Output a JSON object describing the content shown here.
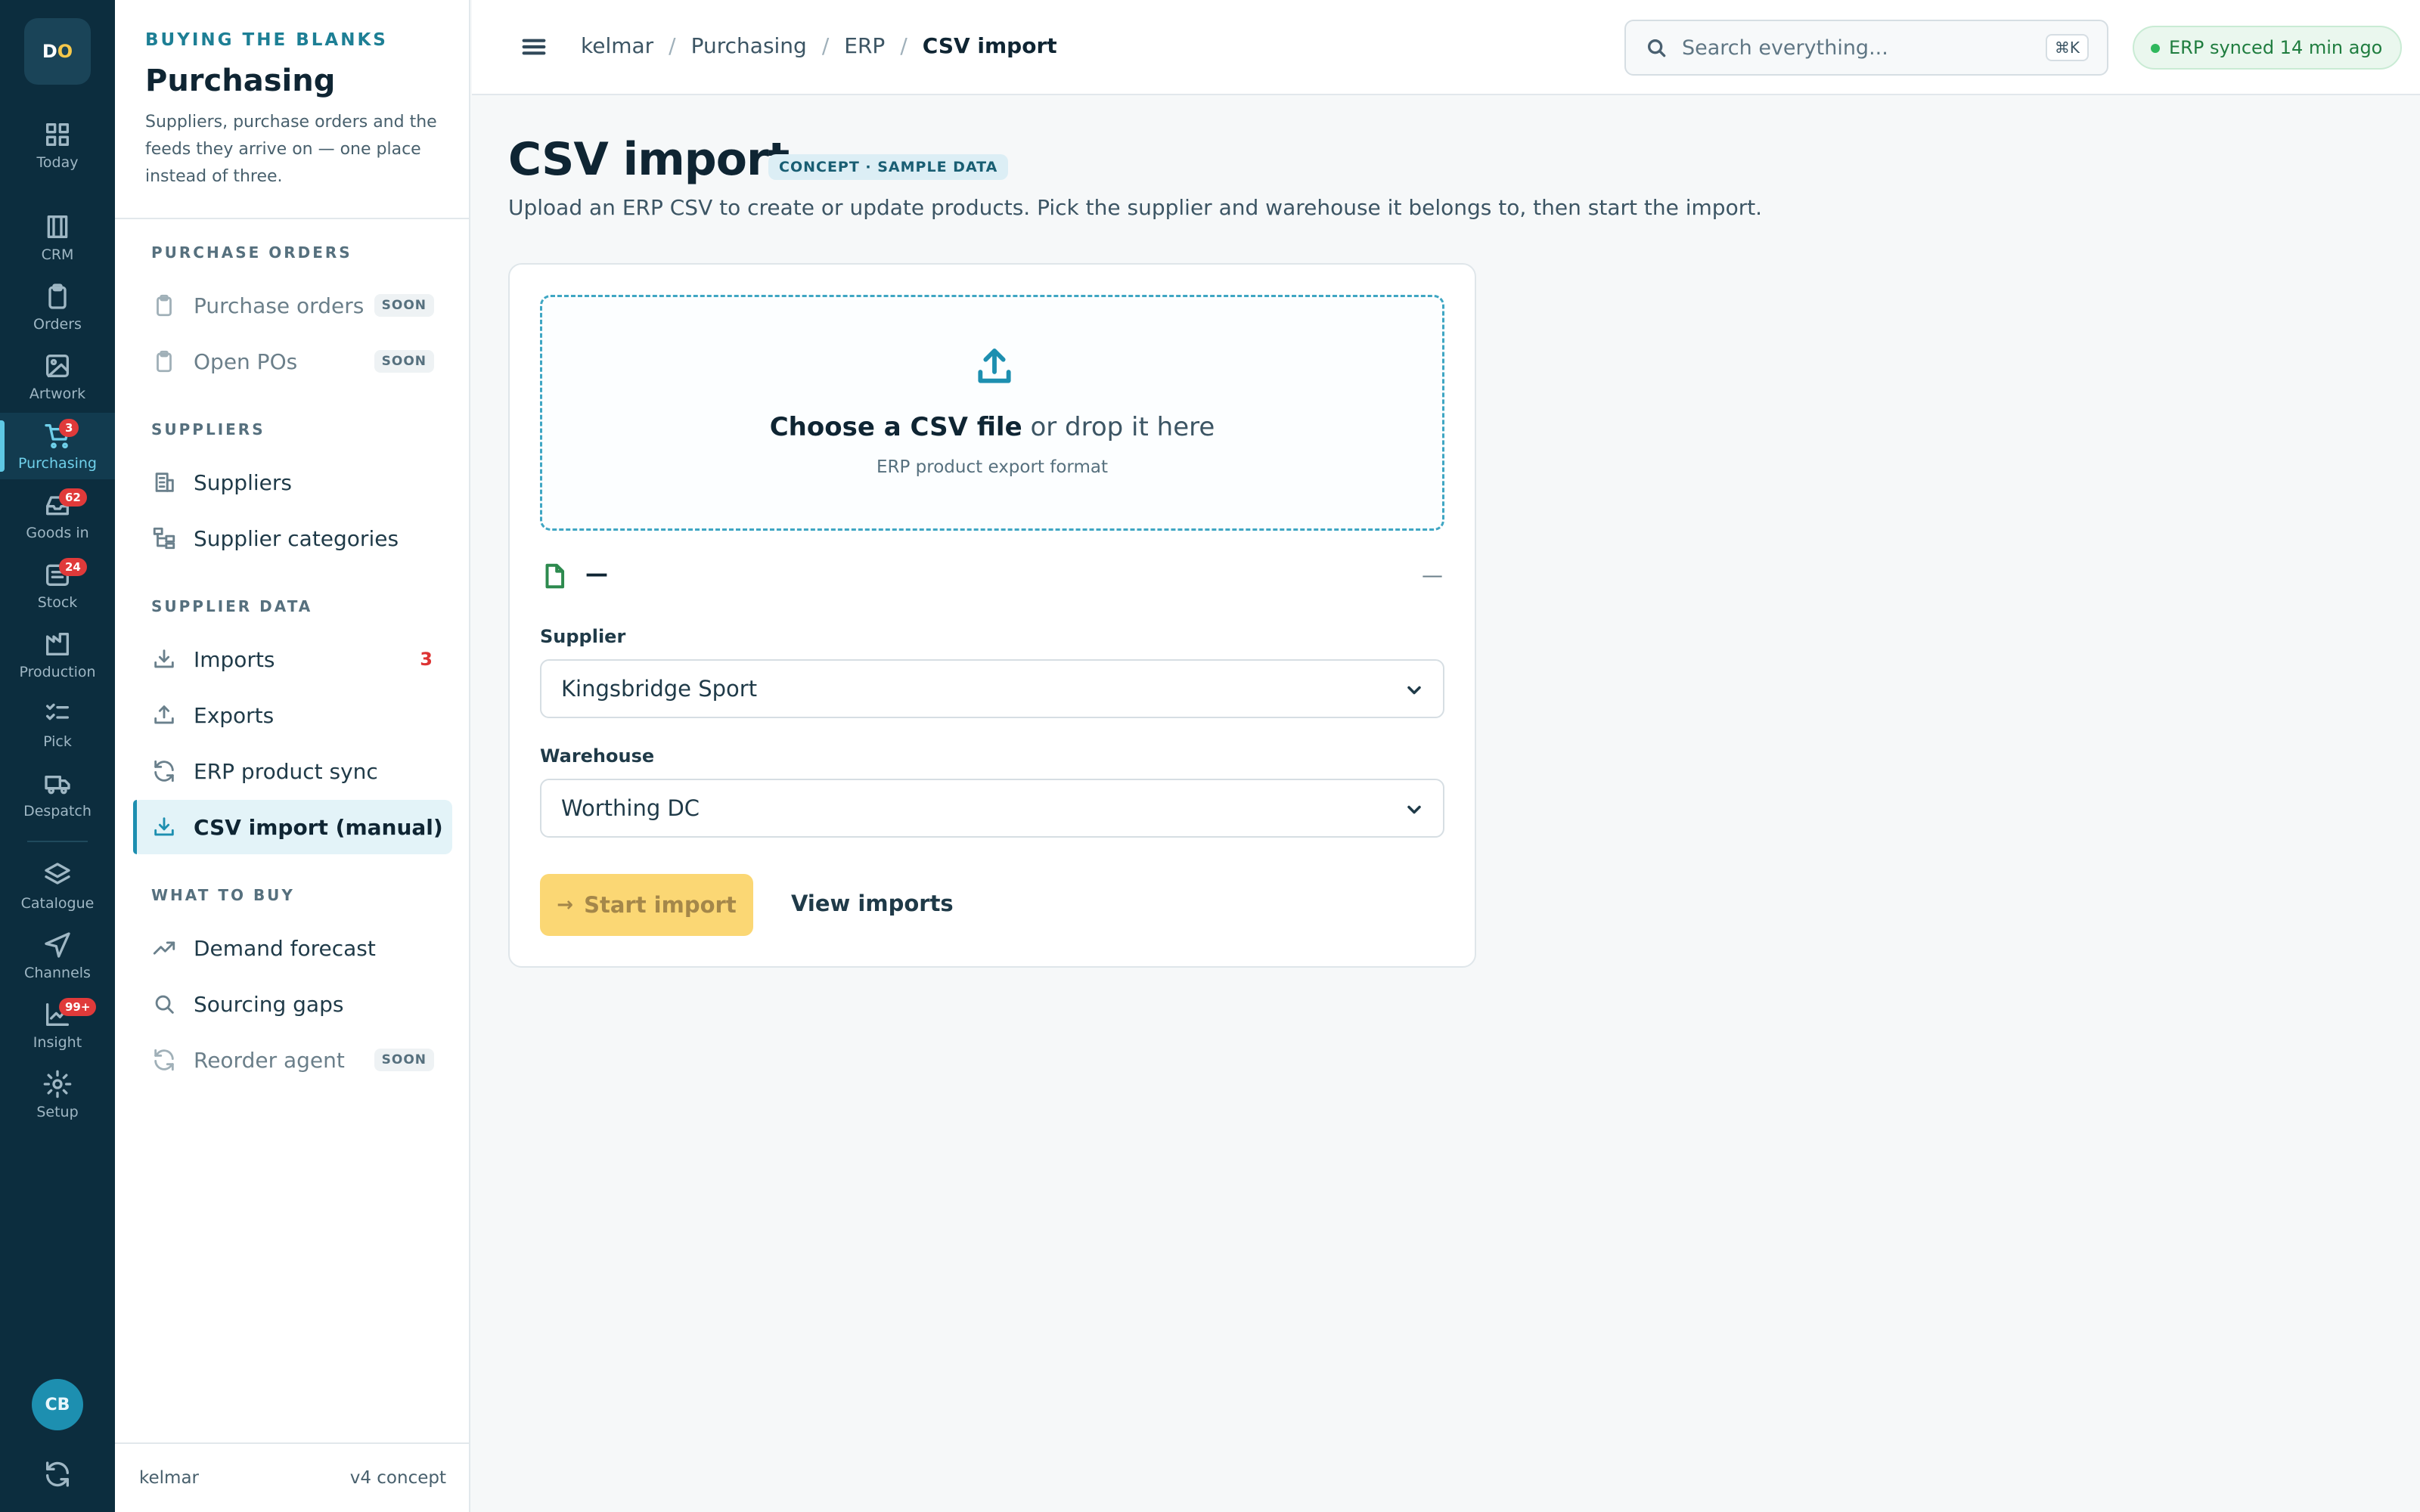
{
  "rail": {
    "logo_d": "D",
    "logo_o": "O",
    "items": [
      {
        "label": "Today",
        "icon": "grid-icon"
      },
      {
        "label": "CRM",
        "icon": "building-icon"
      },
      {
        "label": "Orders",
        "icon": "clipboard-icon"
      },
      {
        "label": "Artwork",
        "icon": "image-icon"
      },
      {
        "label": "Purchasing",
        "icon": "cart-icon",
        "badge": "3"
      },
      {
        "label": "Goods in",
        "icon": "inbox-icon",
        "badge": "62"
      },
      {
        "label": "Stock",
        "icon": "stack-icon",
        "badge": "24"
      },
      {
        "label": "Production",
        "icon": "factory-icon"
      },
      {
        "label": "Pick",
        "icon": "checklist-icon"
      },
      {
        "label": "Despatch",
        "icon": "truck-icon"
      },
      {
        "label": "Catalogue",
        "icon": "layers-icon"
      },
      {
        "label": "Channels",
        "icon": "send-icon"
      },
      {
        "label": "Insight",
        "icon": "chart-icon",
        "badge": "99+"
      },
      {
        "label": "Setup",
        "icon": "gear-icon"
      }
    ],
    "avatar": "CB"
  },
  "side": {
    "eyebrow": "BUYING THE BLANKS",
    "title": "Purchasing",
    "description": "Suppliers, purchase orders and the feeds they arrive on — one place instead of three.",
    "sections": {
      "purchase_orders": "PURCHASE ORDERS",
      "suppliers": "SUPPLIERS",
      "supplier_data": "SUPPLIER DATA",
      "what_to_buy": "WHAT TO BUY"
    },
    "nav": {
      "purchase_orders": "Purchase orders",
      "open_pos": "Open POs",
      "suppliers": "Suppliers",
      "supplier_categories": "Supplier categories",
      "imports": "Imports",
      "imports_count": "3",
      "exports": "Exports",
      "erp_sync": "ERP product sync",
      "csv_import": "CSV import (manual)",
      "demand_forecast": "Demand forecast",
      "sourcing_gaps": "Sourcing gaps",
      "reorder_agent": "Reorder agent"
    },
    "soon": "SOON",
    "footer_left": "kelmar",
    "footer_right": "v4 concept"
  },
  "topbar": {
    "crumbs": [
      "kelmar",
      "Purchasing",
      "ERP",
      "CSV import"
    ],
    "search_placeholder": "Search everything...",
    "shortcut": "⌘K",
    "sync_status": "ERP synced 14 min ago"
  },
  "main": {
    "title": "CSV import",
    "badge": "CONCEPT · SAMPLE DATA",
    "description": "Upload an ERP CSV to create or update products. Pick the supplier and warehouse it belongs to, then start the import.",
    "drop": {
      "choose": "Choose a CSV file",
      "or_drop": "or drop it here",
      "format": "ERP product export format"
    },
    "file": {
      "name": "—",
      "meta": "—"
    },
    "supplier_label": "Supplier",
    "supplier_value": "Kingsbridge Sport",
    "warehouse_label": "Warehouse",
    "warehouse_value": "Worthing DC",
    "start_button": "Start import",
    "view_link": "View imports"
  }
}
